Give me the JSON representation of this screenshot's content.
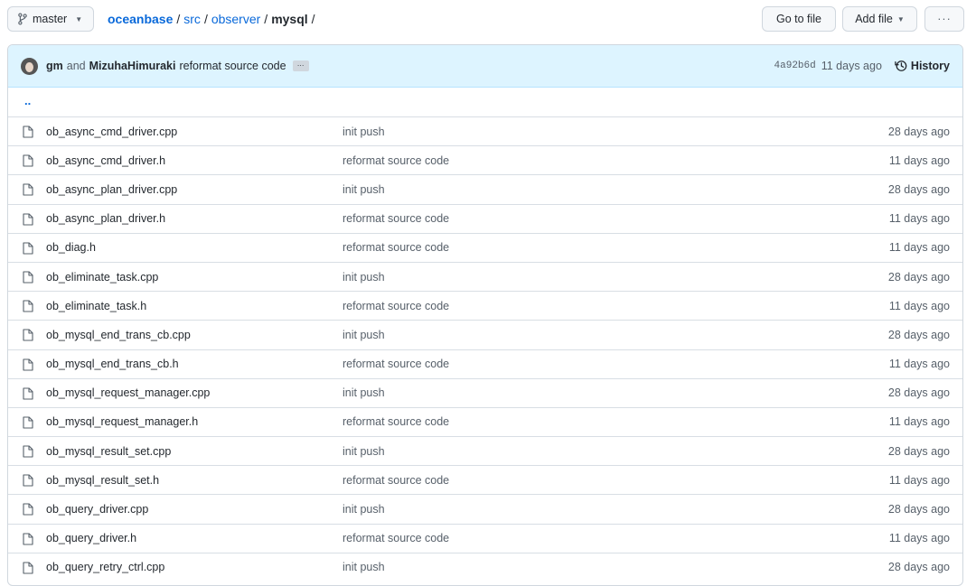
{
  "toolbar": {
    "branch": "master",
    "breadcrumb": {
      "root": "oceanbase",
      "parts": [
        "src",
        "observer"
      ],
      "current": "mysql",
      "separator": "/"
    },
    "go_to_file": "Go to file",
    "add_file": "Add file",
    "more": "···"
  },
  "commit": {
    "author1": "gm",
    "and": "and",
    "author2": "MizuhaHimuraki",
    "message": "reformat source code",
    "ellipsis": "…",
    "sha": "4a92b6d",
    "when": "11 days ago",
    "history": "History"
  },
  "parent_link": "..",
  "files": [
    {
      "name": "ob_async_cmd_driver.cpp",
      "message": "init push",
      "age": "28 days ago"
    },
    {
      "name": "ob_async_cmd_driver.h",
      "message": "reformat source code",
      "age": "11 days ago"
    },
    {
      "name": "ob_async_plan_driver.cpp",
      "message": "init push",
      "age": "28 days ago"
    },
    {
      "name": "ob_async_plan_driver.h",
      "message": "reformat source code",
      "age": "11 days ago"
    },
    {
      "name": "ob_diag.h",
      "message": "reformat source code",
      "age": "11 days ago"
    },
    {
      "name": "ob_eliminate_task.cpp",
      "message": "init push",
      "age": "28 days ago"
    },
    {
      "name": "ob_eliminate_task.h",
      "message": "reformat source code",
      "age": "11 days ago"
    },
    {
      "name": "ob_mysql_end_trans_cb.cpp",
      "message": "init push",
      "age": "28 days ago"
    },
    {
      "name": "ob_mysql_end_trans_cb.h",
      "message": "reformat source code",
      "age": "11 days ago"
    },
    {
      "name": "ob_mysql_request_manager.cpp",
      "message": "init push",
      "age": "28 days ago"
    },
    {
      "name": "ob_mysql_request_manager.h",
      "message": "reformat source code",
      "age": "11 days ago"
    },
    {
      "name": "ob_mysql_result_set.cpp",
      "message": "init push",
      "age": "28 days ago"
    },
    {
      "name": "ob_mysql_result_set.h",
      "message": "reformat source code",
      "age": "11 days ago"
    },
    {
      "name": "ob_query_driver.cpp",
      "message": "init push",
      "age": "28 days ago"
    },
    {
      "name": "ob_query_driver.h",
      "message": "reformat source code",
      "age": "11 days ago"
    },
    {
      "name": "ob_query_retry_ctrl.cpp",
      "message": "init push",
      "age": "28 days ago"
    }
  ]
}
